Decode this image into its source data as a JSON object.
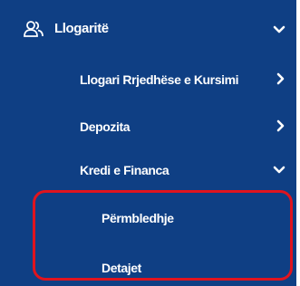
{
  "menu": {
    "accounts": {
      "label": "Llogaritë",
      "icon": "users-icon",
      "state": "expanded"
    },
    "items": [
      {
        "label": "Llogari Rrjedhëse e Kursimi",
        "icon": "chevron-right-icon"
      },
      {
        "label": "Depozita",
        "icon": "chevron-right-icon"
      },
      {
        "label": "Kredi e Financa",
        "icon": "chevron-down-icon",
        "state": "expanded"
      }
    ],
    "subitems": [
      {
        "label": "Përmbledhje"
      },
      {
        "label": "Detajet"
      }
    ]
  },
  "colors": {
    "background": "#0f3f84",
    "text": "#ffffff",
    "highlight": "#e0141e"
  }
}
